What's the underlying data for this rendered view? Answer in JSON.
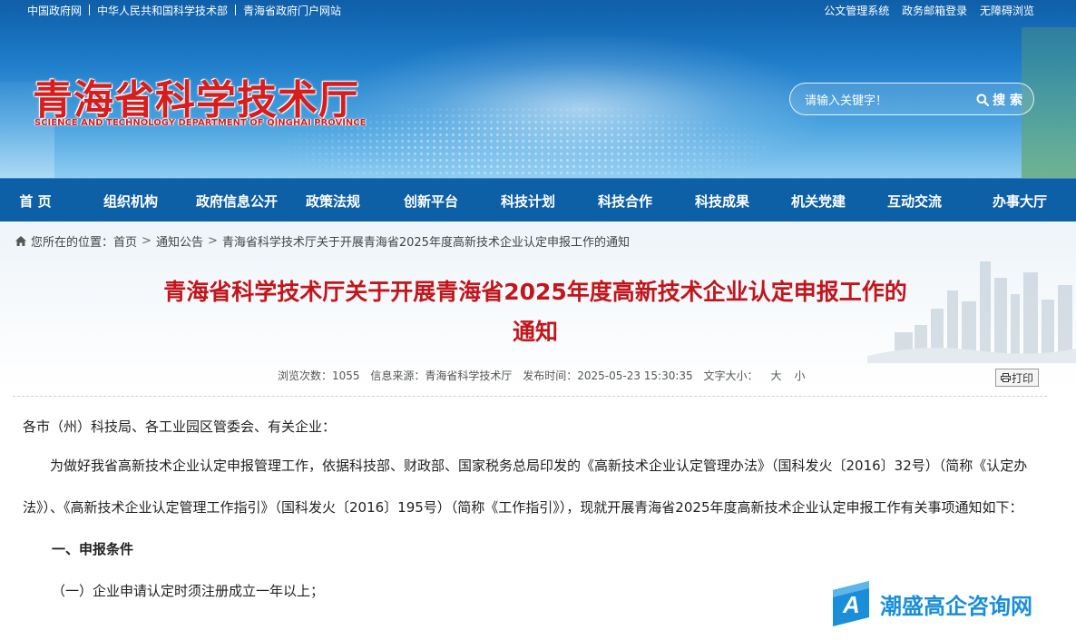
{
  "topbar": {
    "left_links": [
      "中国政府网",
      "中华人民共和国科学技术部",
      "青海省政府门户网站"
    ],
    "right_links": [
      "公文管理系统",
      "政务邮箱登录",
      "无障碍浏览"
    ]
  },
  "logo": {
    "cn": "青海省科学技术厅",
    "en": "SCIENCE AND TECHNOLOGY DEPARTMENT OF QINGHAI PROVINCE"
  },
  "search": {
    "placeholder": "请输入关键字！",
    "button_label": "搜 索"
  },
  "nav": {
    "items": [
      "首 页",
      "组织机构",
      "政府信息公开",
      "政策法规",
      "创新平台",
      "科技计划",
      "科技合作",
      "科技成果",
      "机关党建",
      "互动交流",
      "办事大厅"
    ]
  },
  "breadcrumb": {
    "prefix": "您所在的位置：",
    "items": [
      "首页",
      "通知公告",
      "青海省科学技术厅关于开展青海省2025年度高新技术企业认定申报工作的通知"
    ]
  },
  "article": {
    "title_line1": "青海省科学技术厅关于开展青海省2025年度高新技术企业认定申报工作的",
    "title_line2": "通知",
    "meta": {
      "views": "浏览次数：1055",
      "source": "信息来源：青海省科学技术厅",
      "published": "发布时间：2025-05-23 15:30:35",
      "font_size_label": "文字大小：",
      "size_large": "大",
      "size_small": "小"
    },
    "print_label": "打印",
    "salutation": "各市（州）科技局、各工业园区管委会、有关企业：",
    "paragraph1": "为做好我省高新技术企业认定申报管理工作，依据科技部、财政部、国家税务总局印发的《高新技术企业认定管理办法》（国科发火〔2016〕32号）（简称《认定办法》）、《高新技术企业认定管理工作指引》（国科发火〔2016〕195号）（简称《工作指引》），现就开展青海省2025年度高新技术企业认定申报工作有关事项通知如下：",
    "section1_heading": "一、申报条件",
    "section1_item1": "（一）企业申请认定时须注册成立一年以上；"
  },
  "watermark": {
    "letter": "A",
    "text": "潮盛高企咨询网"
  },
  "colors": {
    "nav_bg": "#0d5fa6",
    "title_red": "#c0161c",
    "logo_red": "#d71d1d",
    "watermark_blue": "#1a8ed8"
  }
}
